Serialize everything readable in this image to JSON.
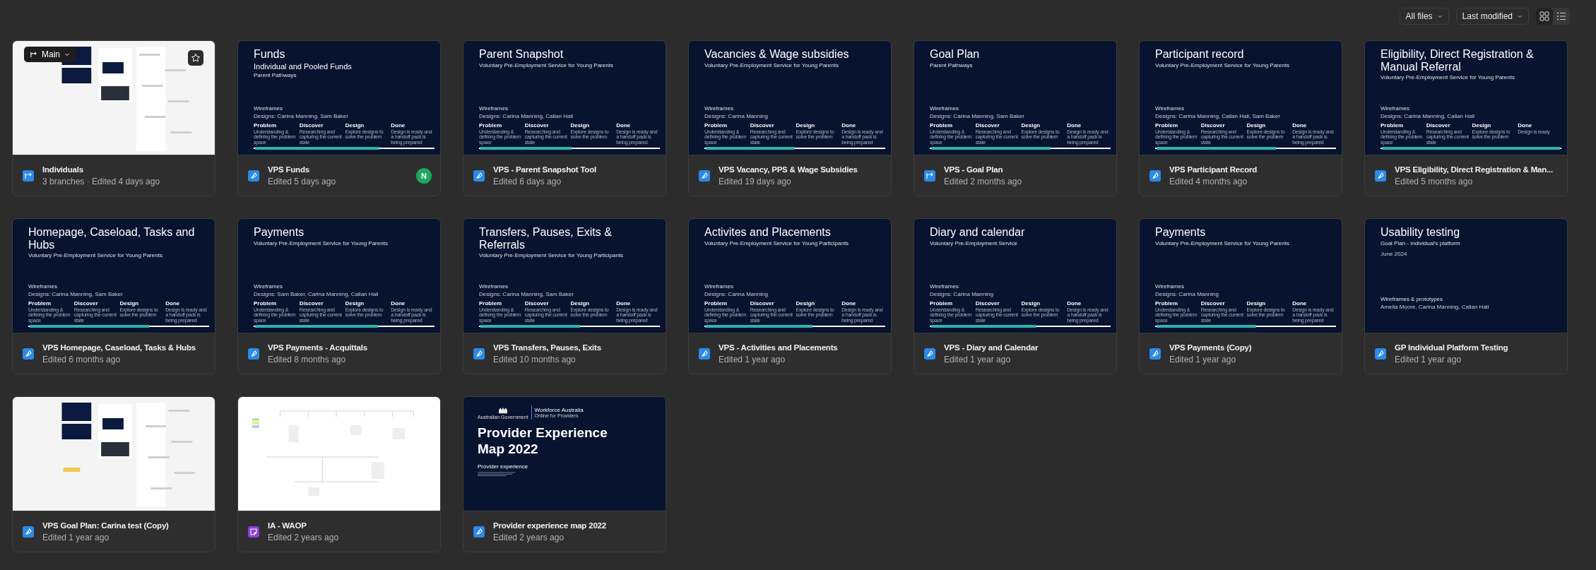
{
  "toolbar": {
    "filter": "All files",
    "sort": "Last modified",
    "view_toggle": [
      {
        "kind": "grid",
        "selected": true
      },
      {
        "kind": "list",
        "selected": false
      }
    ]
  },
  "files": [
    {
      "name": "Individuals",
      "meta": "3 branches · Edited 4 days ago",
      "kind": "branch",
      "branch": "Main",
      "starred": false,
      "thumb": {
        "kind": "canvas"
      }
    },
    {
      "name": "VPS Funds",
      "meta": "Edited 5 days ago",
      "kind": "design",
      "avatar": "N",
      "thumb": {
        "kind": "slide",
        "title": "Funds",
        "subtitle": "Individual and Pooled Funds",
        "tagline": "Parent Pathways",
        "section": "Wireframes",
        "team": "Designs: Carina Manning, Sam Baker",
        "level": 0.7,
        "stages": [
          {
            "name": "Problem",
            "desc": "Understanding & defining the problem space"
          },
          {
            "name": "Discover",
            "desc": "Researching and capturing the current state"
          },
          {
            "name": "Design",
            "desc": "Explore designs to solve the problem"
          },
          {
            "name": "Done",
            "desc": "Design is ready and a handoff pack is being prepared"
          }
        ]
      }
    },
    {
      "name": "VPS - Parent Snapshot Tool",
      "meta": "Edited 6 days ago",
      "kind": "design",
      "thumb": {
        "kind": "slide",
        "title": "Parent Snapshot",
        "tagline": "Voluntary Pre-Employment Service for Young Parents",
        "section": "Wireframes",
        "team": "Designs: Carina Manning, Callan Hall",
        "level": 0.51,
        "stages": [
          {
            "name": "Problem",
            "desc": "Understanding & defining the problem space"
          },
          {
            "name": "Discover",
            "desc": "Researching and capturing the current state"
          },
          {
            "name": "Design",
            "desc": "Explore designs to solve the problem"
          },
          {
            "name": "Done",
            "desc": "Design is ready and a handoff pack is being prepared"
          }
        ]
      }
    },
    {
      "name": "VPS Vacancy, PPS & Wage Subsidies",
      "meta": "Edited 19 days ago",
      "kind": "design",
      "thumb": {
        "kind": "slide",
        "title": "Vacancies & Wage subsidies",
        "tagline": "Voluntary Pre-Employment Service for Young Parents",
        "section": "Wireframes",
        "team": "Designs: Carina Manning",
        "level": 0.5,
        "stages": [
          {
            "name": "Problem",
            "desc": "Understanding & defining the problem space"
          },
          {
            "name": "Discover",
            "desc": "Researching and capturing the current state"
          },
          {
            "name": "Design",
            "desc": "Explore designs to solve the problem"
          },
          {
            "name": "Done",
            "desc": "Design is ready and a handoff pack is being prepared"
          }
        ]
      }
    },
    {
      "name": "VPS - Goal Plan",
      "meta": "Edited 2 months ago",
      "kind": "branch",
      "thumb": {
        "kind": "slide",
        "title": "Goal Plan",
        "tagline": "Parent Pathways",
        "section": "Wireframes",
        "team": "Designs: Carina Manning, Sam Baker",
        "level": 0.67,
        "stages": [
          {
            "name": "Problem",
            "desc": "Understanding & defining the problem space"
          },
          {
            "name": "Discover",
            "desc": "Researching and capturing the current state"
          },
          {
            "name": "Design",
            "desc": "Explore designs to solve the problem"
          },
          {
            "name": "Done",
            "desc": "Design is ready and a handoff pack is being prepared"
          }
        ]
      }
    },
    {
      "name": "VPS Participant Record",
      "meta": "Edited 4 months ago",
      "kind": "design",
      "thumb": {
        "kind": "slide",
        "title": "Participant record",
        "tagline": "Voluntary Pre-Employment Service for Young Parents",
        "section": "Wireframes",
        "team": "Designs: Carina Manning, Callan Hall, Sam Baker",
        "level": 0.67,
        "stages": [
          {
            "name": "Problem",
            "desc": "Understanding & defining the problem space"
          },
          {
            "name": "Discover",
            "desc": "Researching and capturing the current state"
          },
          {
            "name": "Design",
            "desc": "Explore designs to solve the problem"
          },
          {
            "name": "Done",
            "desc": "Design is ready and a handoff pack is being prepared"
          }
        ]
      }
    },
    {
      "name": "VPS Eligibility, Direct Registration & Man...",
      "meta": "Edited 5 months ago",
      "kind": "design",
      "thumb": {
        "kind": "slide",
        "title": "Eligibility, Direct Registration & Manual Referral",
        "tagline": "Voluntary Pre-Employment Service for Young Parents",
        "section": "Wireframes",
        "team": "Designs: Carina Manning, Callan Hall",
        "level": 1,
        "stages": [
          {
            "name": "Problem",
            "desc": "Understanding & defining the problem space"
          },
          {
            "name": "Discover",
            "desc": "Researching and capturing the current state"
          },
          {
            "name": "Design",
            "desc": "Explore designs to solve the problem"
          },
          {
            "name": "Done",
            "desc": "Design is ready"
          }
        ]
      }
    },
    {
      "name": "VPS Homepage, Caseload, Tasks & Hubs",
      "meta": "Edited 6 months ago",
      "kind": "design",
      "thumb": {
        "kind": "slide",
        "title": "Homepage, Caseload, Tasks and Hubs",
        "tagline": "Voluntary Pre-Employment Service for Young Parents",
        "section": "Wireframes",
        "team": "Designs: Carina Manning, Sam Baker",
        "level": 0.67,
        "stages": [
          {
            "name": "Problem",
            "desc": "Understanding & defining the problem space"
          },
          {
            "name": "Discover",
            "desc": "Researching and capturing the current state"
          },
          {
            "name": "Design",
            "desc": "Explore designs to solve the problem"
          },
          {
            "name": "Done",
            "desc": "Design is ready and a handoff pack is being prepared"
          }
        ]
      }
    },
    {
      "name": "VPS Payments - Acquittals",
      "meta": "Edited 8 months ago",
      "kind": "design",
      "thumb": {
        "kind": "slide",
        "title": "Payments",
        "tagline": "Voluntary Pre-Employment Service for Young Parents",
        "section": "Wireframes",
        "team": "Designs: Sam Baker, Carina Manning, Callan Hall",
        "level": 0.69,
        "stages": [
          {
            "name": "Problem",
            "desc": "Understanding & defining the problem space"
          },
          {
            "name": "Discover",
            "desc": "Researching and capturing the current state"
          },
          {
            "name": "Design",
            "desc": "Explore designs to solve the problem"
          },
          {
            "name": "Done",
            "desc": "Design is ready and a handoff pack is being prepared"
          }
        ]
      }
    },
    {
      "name": "VPS Transfers, Pauses, Exits",
      "meta": "Edited 10 months ago",
      "kind": "design",
      "thumb": {
        "kind": "slide",
        "title": "Transfers, Pauses, Exits & Referrals",
        "tagline": "Voluntary Pre-Employment Service for Young Participants",
        "section": "Wireframes",
        "team": "Designs: Carina Manning, Sam Baker",
        "level": 0.56,
        "stages": [
          {
            "name": "Problem",
            "desc": "Understanding & defining the problem space"
          },
          {
            "name": "Discover",
            "desc": "Researching and capturing the current state"
          },
          {
            "name": "Design",
            "desc": "Explore designs to solve the problem"
          },
          {
            "name": "Done",
            "desc": "Design is ready and a handoff pack is being prepared"
          }
        ]
      }
    },
    {
      "name": "VPS - Activities and Placements",
      "meta": "Edited 1 year ago",
      "kind": "design",
      "thumb": {
        "kind": "slide",
        "title": "Activites and Placements",
        "tagline": "Voluntary Pre-Employment Service for Young Participants",
        "section": "Wireframes",
        "team": "Designs: Carina Manning",
        "level": 0.6,
        "stages": [
          {
            "name": "Problem",
            "desc": "Understanding & defining the problem space"
          },
          {
            "name": "Discover",
            "desc": "Researching and capturing the current state"
          },
          {
            "name": "Design",
            "desc": "Explore designs to solve the problem"
          },
          {
            "name": "Done",
            "desc": "Design is ready and a handoff pack is being prepared"
          }
        ]
      }
    },
    {
      "name": "VPS - Diary and Calendar",
      "meta": "Edited 1 year ago",
      "kind": "design",
      "thumb": {
        "kind": "slide",
        "title": "Diary and calendar",
        "tagline": "Voluntary Pre-Employment Service",
        "section": "Wireframes",
        "team": "Designs: Carina Manning",
        "level": 0.59,
        "stages": [
          {
            "name": "Problem",
            "desc": "Understanding & defining the problem space"
          },
          {
            "name": "Discover",
            "desc": "Researching and capturing the current state"
          },
          {
            "name": "Design",
            "desc": "Explore designs to solve the problem"
          },
          {
            "name": "Done",
            "desc": "Design is ready and a handoff pack is being prepared"
          }
        ]
      }
    },
    {
      "name": "VPS Payments (Copy)",
      "meta": "Edited 1 year ago",
      "kind": "design",
      "thumb": {
        "kind": "slide",
        "title": "Payments",
        "tagline": "Voluntary Pre-Employment Service for Young Parents",
        "section": "Wireframes",
        "team": "Designs: Carina Manning",
        "level": 0.56,
        "stages": [
          {
            "name": "Problem",
            "desc": "Understanding & defining the problem space"
          },
          {
            "name": "Discover",
            "desc": "Researching and capturing the current state"
          },
          {
            "name": "Design",
            "desc": "Explore designs to solve the problem"
          },
          {
            "name": "Done",
            "desc": "Design is ready and a handoff pack is being prepared"
          }
        ]
      }
    },
    {
      "name": "GP Individual Platform Testing",
      "meta": "Edited 1 year ago",
      "kind": "design",
      "thumb": {
        "kind": "slide",
        "title": "Usability testing",
        "tagline": "Goal Plan - Individual's platform",
        "date": "June 2024",
        "section": "Wireframes & prototypes",
        "team": "Amelia Moore, Carina Manning, Callan Hall"
      }
    },
    {
      "name": "VPS Goal Plan: Carina test (Copy)",
      "meta": "Edited 1 year ago",
      "kind": "design",
      "thumb": {
        "kind": "canvas"
      }
    },
    {
      "name": "IA - WAOP",
      "meta": "Edited 2 years ago",
      "kind": "board",
      "thumb": {
        "kind": "flow"
      }
    },
    {
      "name": "Provider experience map 2022",
      "meta": "Edited 2 years ago",
      "kind": "design",
      "thumb": {
        "kind": "cover",
        "gov": "Australian Government",
        "org": "Workforce Australia",
        "org_sub": "Online for Providers",
        "title": "Provider Experience Map 2022",
        "section": "Provider experience"
      }
    }
  ]
}
